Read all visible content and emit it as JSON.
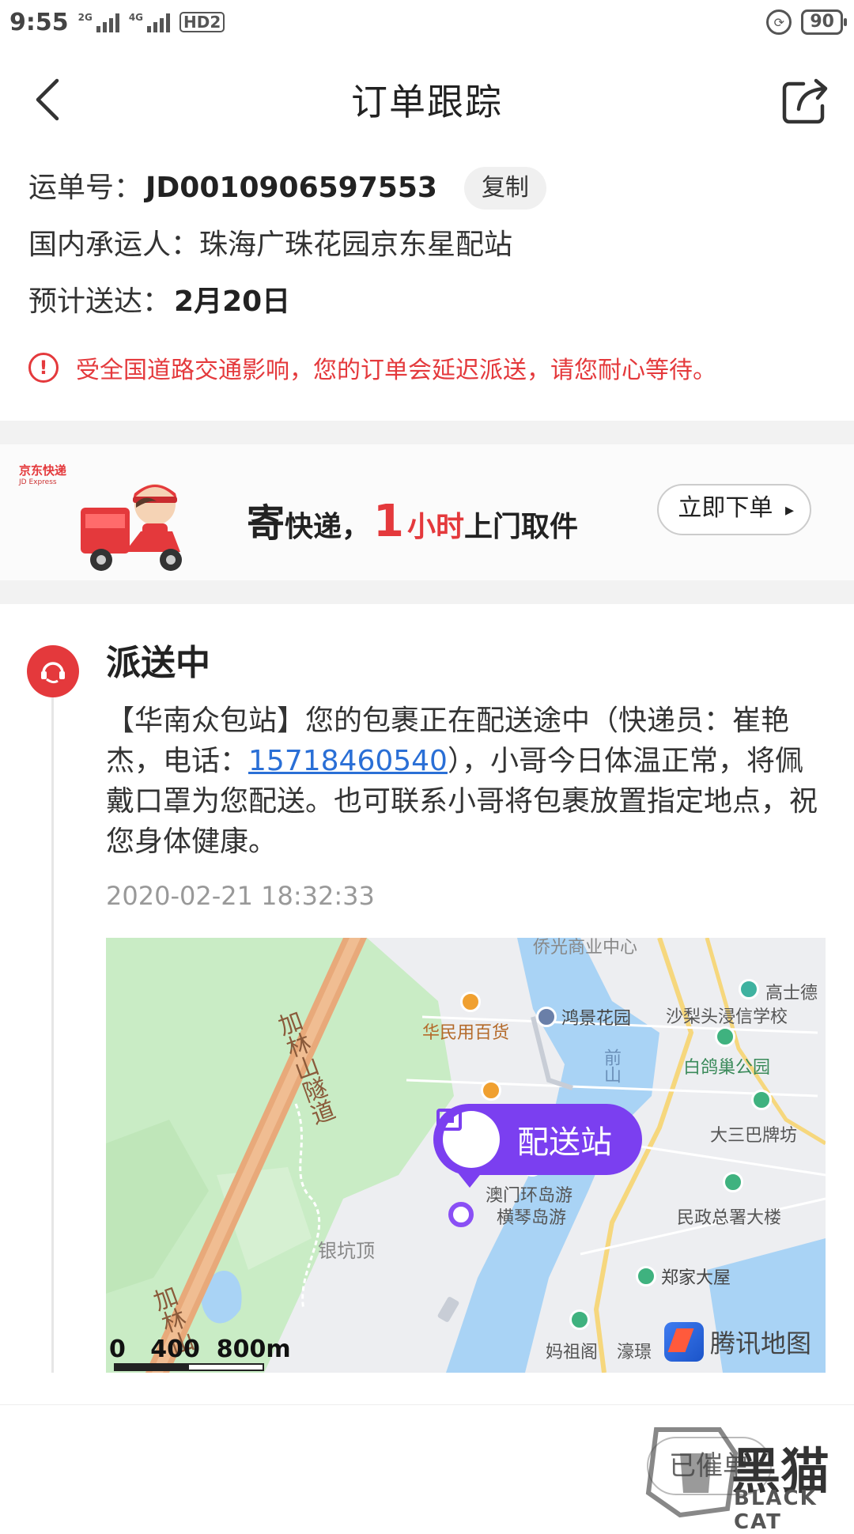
{
  "status_bar": {
    "time": "9:55",
    "net1": "2G",
    "net2": "4G",
    "hd": "HD2",
    "battery": "90"
  },
  "header": {
    "title": "订单跟踪"
  },
  "order_info": {
    "waybill_label": "运单号：",
    "waybill_no": "JD0010906597553",
    "copy_label": "复制",
    "carrier_label": "国内承运人：",
    "carrier": "珠海广珠花园京东星配站",
    "eta_label": "预计送达：",
    "eta": "2月20日",
    "notice": "受全国道路交通影响，您的订单会延迟派送，请您耐心等待。"
  },
  "banner": {
    "logo": "京东快递",
    "logo_en": "JD Express",
    "slogan_1": "寄",
    "slogan_2": "快递，",
    "slogan_3": "1",
    "slogan_4": "小时",
    "slogan_5": "上门取件",
    "button": "立即下单"
  },
  "tracking": {
    "status": "派送中",
    "msg_before_phone": "【华南众包站】您的包裹正在配送途中（快递员：崔艳杰，电话：",
    "phone": "15718460540",
    "msg_after_phone": "），小哥今日体温正常，将佩戴口罩为您配送。也可联系小哥将包裹放置指定地点，祝您身体健康。",
    "time": "2020-02-21 18:32:33"
  },
  "map": {
    "station_label": "配送站",
    "labels": {
      "top": "侨光商业中心",
      "gaoshide": "高士德",
      "shalitou": "沙梨头浸信学校",
      "huamin": "华民用百货",
      "hongjing": "鸿景花园",
      "baigechao": "白鸽巢公园",
      "qianshan": "前山",
      "tunnel1": "加林山隧道",
      "tunnel2": "加林山",
      "dasanba": "大三巴牌坊",
      "aomen1": "澳门环岛游",
      "aomen2": "横琴岛游",
      "minzheng": "民政总署大楼",
      "yinkeng": "银坑顶",
      "zhengjia": "郑家大屋",
      "mazuge": "妈祖阁",
      "haojing": "濠璟"
    },
    "scale_text": "0   400  800m",
    "brand": "腾讯地图"
  },
  "bottom": {
    "remind": "已催单"
  },
  "watermark": {
    "big": "黑猫",
    "text": "BLACK CAT"
  }
}
